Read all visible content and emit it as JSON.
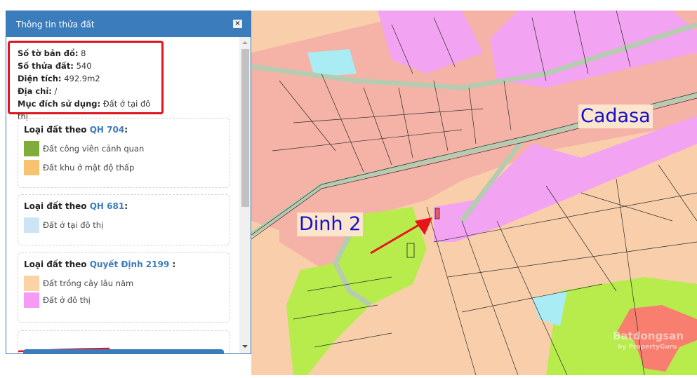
{
  "panel": {
    "title": "Thông tin thửa đất",
    "close_label": "×",
    "info": [
      {
        "label": "Số tờ bản đồ:",
        "value": "8"
      },
      {
        "label": "Số thửa đất:",
        "value": "540"
      },
      {
        "label": "Diện tích:",
        "value": "492.9m2"
      },
      {
        "label": "Địa chỉ:",
        "value": "/"
      },
      {
        "label": "Mục đích sử dụng:",
        "value": "Đất ở tại đô thị"
      }
    ],
    "cards": [
      {
        "prefix": "Loại đất theo ",
        "link": "QH 704",
        "suffix": ":",
        "items": [
          {
            "label": "Đất công viên cảnh quan",
            "color": "#80ad3a"
          },
          {
            "label": "Đất khu ở mật độ thấp",
            "color": "#f7c36e"
          }
        ]
      },
      {
        "prefix": "Loại đất theo ",
        "link": "QH 681",
        "suffix": ":",
        "items": [
          {
            "label": "Đất ở tại đô thị",
            "color": "#cde4f7"
          }
        ]
      },
      {
        "prefix": "Loại đất theo ",
        "link": "Quyết Định 2199",
        "suffix": " :",
        "items": [
          {
            "label": "Đất trồng cây lâu năm",
            "color": "#fbd3a4"
          },
          {
            "label": "Đất ở đô thị",
            "color": "#f59af5"
          }
        ]
      }
    ]
  },
  "map": {
    "labels": {
      "cadasa": "Cadasa",
      "dinh2": "Dinh 2"
    },
    "watermark": "Batdongsan",
    "watermark_sub": "by PropertyGuru",
    "colors": {
      "residential": "#f4b3a6",
      "urban": "#f2a3f2",
      "perennial": "#f9cfab",
      "green": "#b7ec4c",
      "water": "#a9ecf4",
      "arrow": "#e8141c"
    }
  }
}
